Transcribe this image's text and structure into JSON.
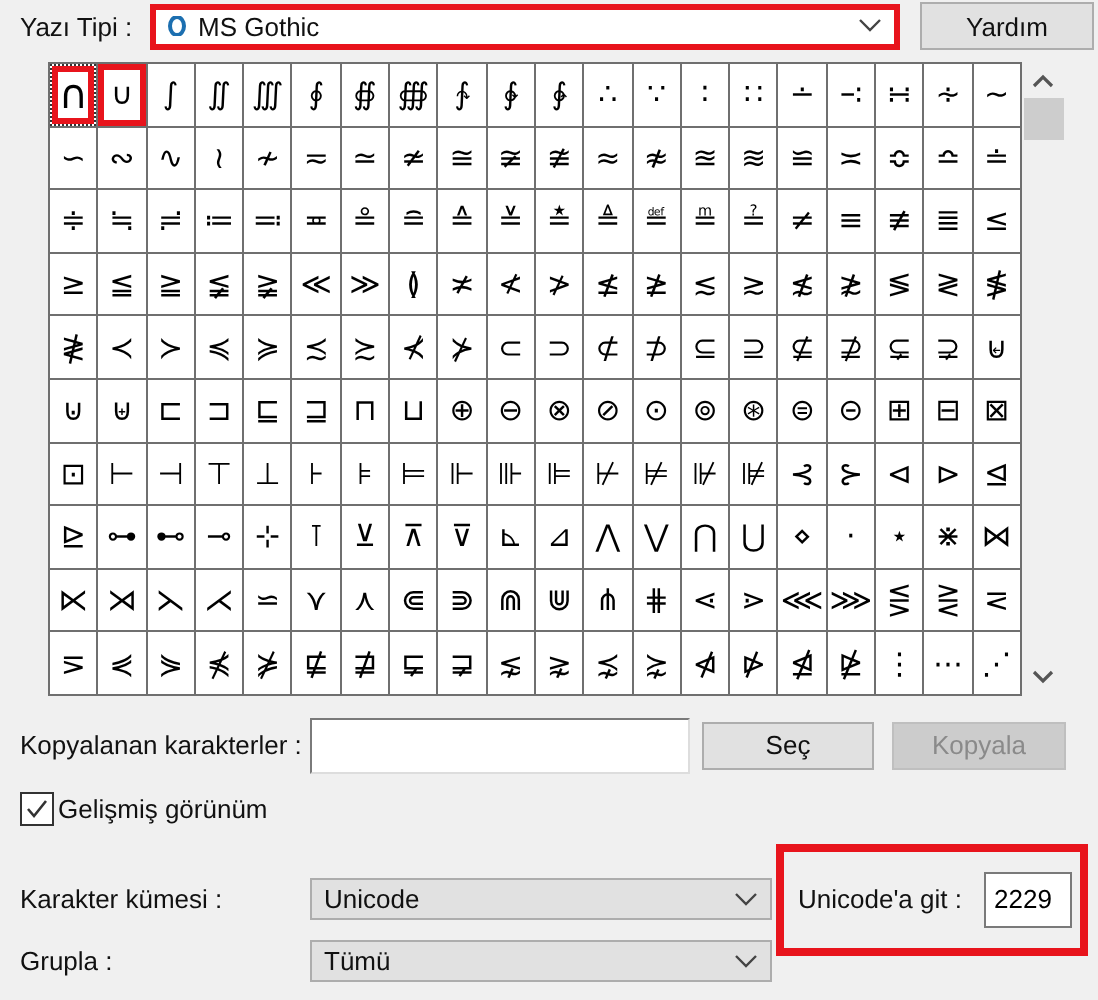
{
  "font": {
    "label": "Yazı Tipi :",
    "value": "MS Gothic",
    "highlighted": true
  },
  "help_button": "Yardım",
  "characters": [
    {
      "char": "∩",
      "selected": true,
      "highlighted": true
    },
    {
      "char": "∪",
      "selected": false,
      "highlighted": true
    },
    {
      "char": "∫",
      "selected": false,
      "highlighted": false
    },
    {
      "char": "∬",
      "selected": false,
      "highlighted": false
    },
    {
      "char": "∭",
      "selected": false,
      "highlighted": false
    },
    {
      "char": "∮",
      "selected": false,
      "highlighted": false
    },
    {
      "char": "∯",
      "selected": false,
      "highlighted": false
    },
    {
      "char": "∰",
      "selected": false,
      "highlighted": false
    },
    {
      "char": "∱",
      "selected": false,
      "highlighted": false
    },
    {
      "char": "∲",
      "selected": false,
      "highlighted": false
    },
    {
      "char": "∳",
      "selected": false,
      "highlighted": false
    },
    {
      "char": "∴",
      "selected": false,
      "highlighted": false
    },
    {
      "char": "∵",
      "selected": false,
      "highlighted": false
    },
    {
      "char": "∶",
      "selected": false,
      "highlighted": false
    },
    {
      "char": "∷",
      "selected": false,
      "highlighted": false
    },
    {
      "char": "∸",
      "selected": false,
      "highlighted": false
    },
    {
      "char": "∹",
      "selected": false,
      "highlighted": false
    },
    {
      "char": "∺",
      "selected": false,
      "highlighted": false
    },
    {
      "char": "∻",
      "selected": false,
      "highlighted": false
    },
    {
      "char": "∼",
      "selected": false,
      "highlighted": false
    },
    {
      "char": "∽",
      "selected": false,
      "highlighted": false
    },
    {
      "char": "∾",
      "selected": false,
      "highlighted": false
    },
    {
      "char": "∿",
      "selected": false,
      "highlighted": false
    },
    {
      "char": "≀",
      "selected": false,
      "highlighted": false
    },
    {
      "char": "≁",
      "selected": false,
      "highlighted": false
    },
    {
      "char": "≂",
      "selected": false,
      "highlighted": false
    },
    {
      "char": "≃",
      "selected": false,
      "highlighted": false
    },
    {
      "char": "≄",
      "selected": false,
      "highlighted": false
    },
    {
      "char": "≅",
      "selected": false,
      "highlighted": false
    },
    {
      "char": "≆",
      "selected": false,
      "highlighted": false
    },
    {
      "char": "≇",
      "selected": false,
      "highlighted": false
    },
    {
      "char": "≈",
      "selected": false,
      "highlighted": false
    },
    {
      "char": "≉",
      "selected": false,
      "highlighted": false
    },
    {
      "char": "≊",
      "selected": false,
      "highlighted": false
    },
    {
      "char": "≋",
      "selected": false,
      "highlighted": false
    },
    {
      "char": "≌",
      "selected": false,
      "highlighted": false
    },
    {
      "char": "≍",
      "selected": false,
      "highlighted": false
    },
    {
      "char": "≎",
      "selected": false,
      "highlighted": false
    },
    {
      "char": "≏",
      "selected": false,
      "highlighted": false
    },
    {
      "char": "≐",
      "selected": false,
      "highlighted": false
    },
    {
      "char": "≑",
      "selected": false,
      "highlighted": false
    },
    {
      "char": "≒",
      "selected": false,
      "highlighted": false
    },
    {
      "char": "≓",
      "selected": false,
      "highlighted": false
    },
    {
      "char": "≔",
      "selected": false,
      "highlighted": false
    },
    {
      "char": "≕",
      "selected": false,
      "highlighted": false
    },
    {
      "char": "≖",
      "selected": false,
      "highlighted": false
    },
    {
      "char": "≗",
      "selected": false,
      "highlighted": false
    },
    {
      "char": "≘",
      "selected": false,
      "highlighted": false
    },
    {
      "char": "≙",
      "selected": false,
      "highlighted": false
    },
    {
      "char": "≚",
      "selected": false,
      "highlighted": false
    },
    {
      "char": "≛",
      "selected": false,
      "highlighted": false
    },
    {
      "char": "≜",
      "selected": false,
      "highlighted": false
    },
    {
      "char": "≝",
      "selected": false,
      "highlighted": false
    },
    {
      "char": "≞",
      "selected": false,
      "highlighted": false
    },
    {
      "char": "≟",
      "selected": false,
      "highlighted": false
    },
    {
      "char": "≠",
      "selected": false,
      "highlighted": false
    },
    {
      "char": "≡",
      "selected": false,
      "highlighted": false
    },
    {
      "char": "≢",
      "selected": false,
      "highlighted": false
    },
    {
      "char": "≣",
      "selected": false,
      "highlighted": false
    },
    {
      "char": "≤",
      "selected": false,
      "highlighted": false
    },
    {
      "char": "≥",
      "selected": false,
      "highlighted": false
    },
    {
      "char": "≦",
      "selected": false,
      "highlighted": false
    },
    {
      "char": "≧",
      "selected": false,
      "highlighted": false
    },
    {
      "char": "≨",
      "selected": false,
      "highlighted": false
    },
    {
      "char": "≩",
      "selected": false,
      "highlighted": false
    },
    {
      "char": "≪",
      "selected": false,
      "highlighted": false
    },
    {
      "char": "≫",
      "selected": false,
      "highlighted": false
    },
    {
      "char": "≬",
      "selected": false,
      "highlighted": false
    },
    {
      "char": "≭",
      "selected": false,
      "highlighted": false
    },
    {
      "char": "≮",
      "selected": false,
      "highlighted": false
    },
    {
      "char": "≯",
      "selected": false,
      "highlighted": false
    },
    {
      "char": "≰",
      "selected": false,
      "highlighted": false
    },
    {
      "char": "≱",
      "selected": false,
      "highlighted": false
    },
    {
      "char": "≲",
      "selected": false,
      "highlighted": false
    },
    {
      "char": "≳",
      "selected": false,
      "highlighted": false
    },
    {
      "char": "≴",
      "selected": false,
      "highlighted": false
    },
    {
      "char": "≵",
      "selected": false,
      "highlighted": false
    },
    {
      "char": "≶",
      "selected": false,
      "highlighted": false
    },
    {
      "char": "≷",
      "selected": false,
      "highlighted": false
    },
    {
      "char": "≸",
      "selected": false,
      "highlighted": false
    },
    {
      "char": "≹",
      "selected": false,
      "highlighted": false
    },
    {
      "char": "≺",
      "selected": false,
      "highlighted": false
    },
    {
      "char": "≻",
      "selected": false,
      "highlighted": false
    },
    {
      "char": "≼",
      "selected": false,
      "highlighted": false
    },
    {
      "char": "≽",
      "selected": false,
      "highlighted": false
    },
    {
      "char": "≾",
      "selected": false,
      "highlighted": false
    },
    {
      "char": "≿",
      "selected": false,
      "highlighted": false
    },
    {
      "char": "⊀",
      "selected": false,
      "highlighted": false
    },
    {
      "char": "⊁",
      "selected": false,
      "highlighted": false
    },
    {
      "char": "⊂",
      "selected": false,
      "highlighted": false
    },
    {
      "char": "⊃",
      "selected": false,
      "highlighted": false
    },
    {
      "char": "⊄",
      "selected": false,
      "highlighted": false
    },
    {
      "char": "⊅",
      "selected": false,
      "highlighted": false
    },
    {
      "char": "⊆",
      "selected": false,
      "highlighted": false
    },
    {
      "char": "⊇",
      "selected": false,
      "highlighted": false
    },
    {
      "char": "⊈",
      "selected": false,
      "highlighted": false
    },
    {
      "char": "⊉",
      "selected": false,
      "highlighted": false
    },
    {
      "char": "⊊",
      "selected": false,
      "highlighted": false
    },
    {
      "char": "⊋",
      "selected": false,
      "highlighted": false
    },
    {
      "char": "⊌",
      "selected": false,
      "highlighted": false
    },
    {
      "char": "⊍",
      "selected": false,
      "highlighted": false
    },
    {
      "char": "⊎",
      "selected": false,
      "highlighted": false
    },
    {
      "char": "⊏",
      "selected": false,
      "highlighted": false
    },
    {
      "char": "⊐",
      "selected": false,
      "highlighted": false
    },
    {
      "char": "⊑",
      "selected": false,
      "highlighted": false
    },
    {
      "char": "⊒",
      "selected": false,
      "highlighted": false
    },
    {
      "char": "⊓",
      "selected": false,
      "highlighted": false
    },
    {
      "char": "⊔",
      "selected": false,
      "highlighted": false
    },
    {
      "char": "⊕",
      "selected": false,
      "highlighted": false
    },
    {
      "char": "⊖",
      "selected": false,
      "highlighted": false
    },
    {
      "char": "⊗",
      "selected": false,
      "highlighted": false
    },
    {
      "char": "⊘",
      "selected": false,
      "highlighted": false
    },
    {
      "char": "⊙",
      "selected": false,
      "highlighted": false
    },
    {
      "char": "⊚",
      "selected": false,
      "highlighted": false
    },
    {
      "char": "⊛",
      "selected": false,
      "highlighted": false
    },
    {
      "char": "⊜",
      "selected": false,
      "highlighted": false
    },
    {
      "char": "⊝",
      "selected": false,
      "highlighted": false
    },
    {
      "char": "⊞",
      "selected": false,
      "highlighted": false
    },
    {
      "char": "⊟",
      "selected": false,
      "highlighted": false
    },
    {
      "char": "⊠",
      "selected": false,
      "highlighted": false
    },
    {
      "char": "⊡",
      "selected": false,
      "highlighted": false
    },
    {
      "char": "⊢",
      "selected": false,
      "highlighted": false
    },
    {
      "char": "⊣",
      "selected": false,
      "highlighted": false
    },
    {
      "char": "⊤",
      "selected": false,
      "highlighted": false
    },
    {
      "char": "⊥",
      "selected": false,
      "highlighted": false
    },
    {
      "char": "⊦",
      "selected": false,
      "highlighted": false
    },
    {
      "char": "⊧",
      "selected": false,
      "highlighted": false
    },
    {
      "char": "⊨",
      "selected": false,
      "highlighted": false
    },
    {
      "char": "⊩",
      "selected": false,
      "highlighted": false
    },
    {
      "char": "⊪",
      "selected": false,
      "highlighted": false
    },
    {
      "char": "⊫",
      "selected": false,
      "highlighted": false
    },
    {
      "char": "⊬",
      "selected": false,
      "highlighted": false
    },
    {
      "char": "⊭",
      "selected": false,
      "highlighted": false
    },
    {
      "char": "⊮",
      "selected": false,
      "highlighted": false
    },
    {
      "char": "⊯",
      "selected": false,
      "highlighted": false
    },
    {
      "char": "⊰",
      "selected": false,
      "highlighted": false
    },
    {
      "char": "⊱",
      "selected": false,
      "highlighted": false
    },
    {
      "char": "⊲",
      "selected": false,
      "highlighted": false
    },
    {
      "char": "⊳",
      "selected": false,
      "highlighted": false
    },
    {
      "char": "⊴",
      "selected": false,
      "highlighted": false
    },
    {
      "char": "⊵",
      "selected": false,
      "highlighted": false
    },
    {
      "char": "⊶",
      "selected": false,
      "highlighted": false
    },
    {
      "char": "⊷",
      "selected": false,
      "highlighted": false
    },
    {
      "char": "⊸",
      "selected": false,
      "highlighted": false
    },
    {
      "char": "⊹",
      "selected": false,
      "highlighted": false
    },
    {
      "char": "⊺",
      "selected": false,
      "highlighted": false
    },
    {
      "char": "⊻",
      "selected": false,
      "highlighted": false
    },
    {
      "char": "⊼",
      "selected": false,
      "highlighted": false
    },
    {
      "char": "⊽",
      "selected": false,
      "highlighted": false
    },
    {
      "char": "⊾",
      "selected": false,
      "highlighted": false
    },
    {
      "char": "⊿",
      "selected": false,
      "highlighted": false
    },
    {
      "char": "⋀",
      "selected": false,
      "highlighted": false
    },
    {
      "char": "⋁",
      "selected": false,
      "highlighted": false
    },
    {
      "char": "⋂",
      "selected": false,
      "highlighted": false
    },
    {
      "char": "⋃",
      "selected": false,
      "highlighted": false
    },
    {
      "char": "⋄",
      "selected": false,
      "highlighted": false
    },
    {
      "char": "⋅",
      "selected": false,
      "highlighted": false
    },
    {
      "char": "⋆",
      "selected": false,
      "highlighted": false
    },
    {
      "char": "⋇",
      "selected": false,
      "highlighted": false
    },
    {
      "char": "⋈",
      "selected": false,
      "highlighted": false
    },
    {
      "char": "⋉",
      "selected": false,
      "highlighted": false
    },
    {
      "char": "⋊",
      "selected": false,
      "highlighted": false
    },
    {
      "char": "⋋",
      "selected": false,
      "highlighted": false
    },
    {
      "char": "⋌",
      "selected": false,
      "highlighted": false
    },
    {
      "char": "⋍",
      "selected": false,
      "highlighted": false
    },
    {
      "char": "⋎",
      "selected": false,
      "highlighted": false
    },
    {
      "char": "⋏",
      "selected": false,
      "highlighted": false
    },
    {
      "char": "⋐",
      "selected": false,
      "highlighted": false
    },
    {
      "char": "⋑",
      "selected": false,
      "highlighted": false
    },
    {
      "char": "⋒",
      "selected": false,
      "highlighted": false
    },
    {
      "char": "⋓",
      "selected": false,
      "highlighted": false
    },
    {
      "char": "⋔",
      "selected": false,
      "highlighted": false
    },
    {
      "char": "⋕",
      "selected": false,
      "highlighted": false
    },
    {
      "char": "⋖",
      "selected": false,
      "highlighted": false
    },
    {
      "char": "⋗",
      "selected": false,
      "highlighted": false
    },
    {
      "char": "⋘",
      "selected": false,
      "highlighted": false
    },
    {
      "char": "⋙",
      "selected": false,
      "highlighted": false
    },
    {
      "char": "⋚",
      "selected": false,
      "highlighted": false
    },
    {
      "char": "⋛",
      "selected": false,
      "highlighted": false
    },
    {
      "char": "⋜",
      "selected": false,
      "highlighted": false
    },
    {
      "char": "⋝",
      "selected": false,
      "highlighted": false
    },
    {
      "char": "⋞",
      "selected": false,
      "highlighted": false
    },
    {
      "char": "⋟",
      "selected": false,
      "highlighted": false
    },
    {
      "char": "⋠",
      "selected": false,
      "highlighted": false
    },
    {
      "char": "⋡",
      "selected": false,
      "highlighted": false
    },
    {
      "char": "⋢",
      "selected": false,
      "highlighted": false
    },
    {
      "char": "⋣",
      "selected": false,
      "highlighted": false
    },
    {
      "char": "⋤",
      "selected": false,
      "highlighted": false
    },
    {
      "char": "⋥",
      "selected": false,
      "highlighted": false
    },
    {
      "char": "⋦",
      "selected": false,
      "highlighted": false
    },
    {
      "char": "⋧",
      "selected": false,
      "highlighted": false
    },
    {
      "char": "⋨",
      "selected": false,
      "highlighted": false
    },
    {
      "char": "⋩",
      "selected": false,
      "highlighted": false
    },
    {
      "char": "⋪",
      "selected": false,
      "highlighted": false
    },
    {
      "char": "⋫",
      "selected": false,
      "highlighted": false
    },
    {
      "char": "⋬",
      "selected": false,
      "highlighted": false
    },
    {
      "char": "⋭",
      "selected": false,
      "highlighted": false
    },
    {
      "char": "⋮",
      "selected": false,
      "highlighted": false
    },
    {
      "char": "⋯",
      "selected": false,
      "highlighted": false
    },
    {
      "char": "⋰",
      "selected": false,
      "highlighted": false
    }
  ],
  "copy": {
    "label": "Kopyalanan karakterler :",
    "select_button": "Seç",
    "copy_button": "Kopyala",
    "copy_disabled": true
  },
  "advanced_view": {
    "label": "Gelişmiş görünüm",
    "checked": true
  },
  "charset": {
    "label": "Karakter kümesi :",
    "value": "Unicode"
  },
  "goto": {
    "label": "Unicode'a git :",
    "value": "2229",
    "highlighted": true
  },
  "group": {
    "label": "Grupla :",
    "value": "Tümü"
  }
}
